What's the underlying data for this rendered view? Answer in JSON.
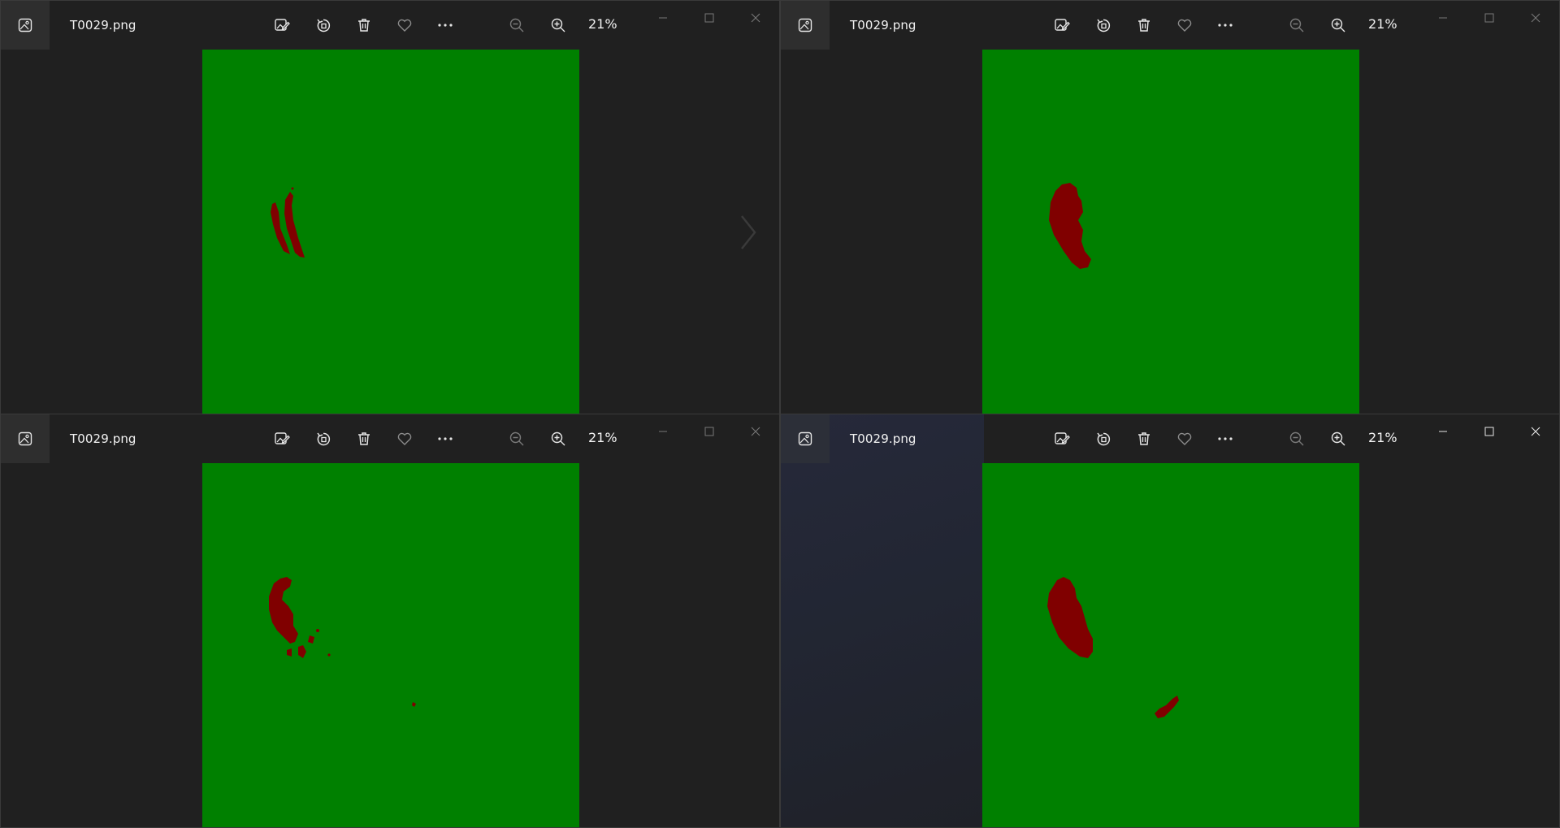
{
  "colors": {
    "mask_background": "#008000",
    "mask_region": "#800000",
    "window_background": "#202020"
  },
  "windows": [
    {
      "position": "top-left",
      "file_name": "T0029.png",
      "zoom": "21%",
      "toolbar": [
        "edit-image-icon",
        "rotate-icon",
        "delete-icon",
        "favorite-icon",
        "more-options-icon"
      ],
      "zoom_controls": [
        "zoom-out-icon",
        "zoom-in-icon"
      ],
      "caption_buttons": [
        "minimize-icon",
        "maximize-icon",
        "close-icon"
      ]
    },
    {
      "position": "top-right",
      "file_name": "T0029.png",
      "zoom": "21%",
      "toolbar": [
        "edit-image-icon",
        "rotate-icon",
        "delete-icon",
        "favorite-icon",
        "more-options-icon"
      ],
      "zoom_controls": [
        "zoom-out-icon",
        "zoom-in-icon"
      ],
      "caption_buttons": [
        "minimize-icon",
        "maximize-icon",
        "close-icon"
      ]
    },
    {
      "position": "bottom-left",
      "file_name": "T0029.png",
      "zoom": "21%",
      "toolbar": [
        "edit-image-icon",
        "rotate-icon",
        "delete-icon",
        "favorite-icon",
        "more-options-icon"
      ],
      "zoom_controls": [
        "zoom-out-icon",
        "zoom-in-icon"
      ],
      "caption_buttons": [
        "minimize-icon",
        "maximize-icon",
        "close-icon"
      ]
    },
    {
      "position": "bottom-right",
      "file_name": "T0029.png",
      "zoom": "21%",
      "toolbar": [
        "edit-image-icon",
        "rotate-icon",
        "delete-icon",
        "favorite-icon",
        "more-options-icon"
      ],
      "zoom_controls": [
        "zoom-out-icon",
        "zoom-in-icon"
      ],
      "caption_buttons": [
        "minimize-icon",
        "maximize-icon",
        "close-icon"
      ]
    }
  ]
}
